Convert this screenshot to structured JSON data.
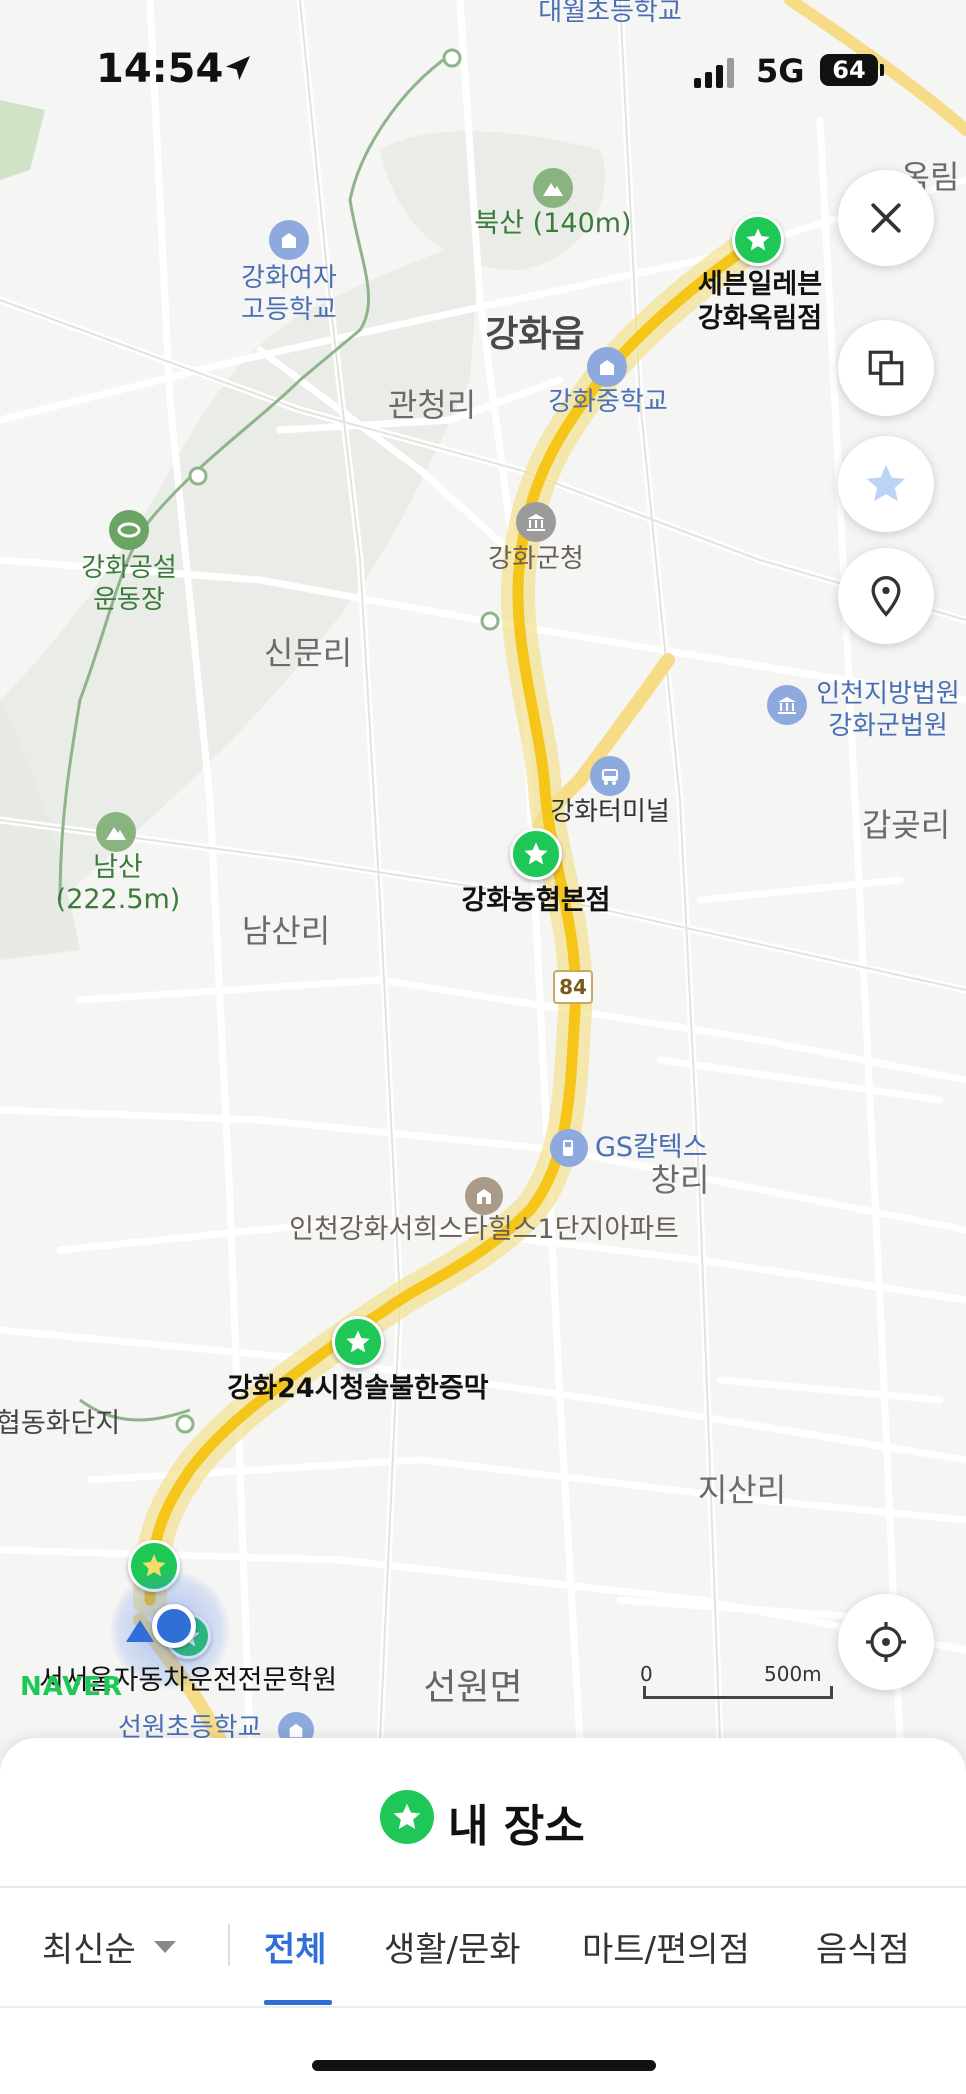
{
  "status_bar": {
    "time": "14:54",
    "network": "5G",
    "battery": "64"
  },
  "map": {
    "areas": {
      "ganghwa_eup": "강화읍",
      "gwancheong_ri": "관청리",
      "sinmun_ri": "신문리",
      "namsan_ri": "남산리",
      "gapgot_ri": "갑곶리",
      "changri": "창리",
      "jisan_ri": "지산리",
      "seonwon_myeon": "선원면",
      "ok_rim": "옥림"
    },
    "pois": {
      "daewol_school": "대월초등학교",
      "buksan": "북산 (140m)",
      "girls_high_1": "강화여자",
      "girls_high_2": "고등학교",
      "middle_school": "강화중학교",
      "gunchung": "강화군청",
      "stadium_1": "강화공설",
      "stadium_2": "운동장",
      "court_1": "인천지방법원",
      "court_2": "강화군법원",
      "terminal": "강화터미널",
      "namsan_1": "남산",
      "namsan_2": "(222.5m)",
      "gs": "GS칼텍스",
      "apartment": "인천강화서희스타힐스1단지아파트",
      "hyeopdong": "협동화단지",
      "seonwon_school": "선원초등학교"
    },
    "road_number": "84",
    "saved_places": {
      "seven_1": "세븐일레븐",
      "seven_2": "강화옥림점",
      "nonghyup": "강화농협본점",
      "jeungmak": "강화24시청솔불한증막",
      "driving": "서서울자동차운전전문학원"
    },
    "scale": {
      "zero": "0",
      "distance": "500m"
    },
    "brand": "NAVER"
  },
  "sheet": {
    "title": "내 장소",
    "sort_label": "최신순",
    "tabs": [
      "전체",
      "생활/문화",
      "마트/편의점",
      "음식점"
    ],
    "active_tab": 0
  },
  "colors": {
    "route": "#f6c51a",
    "pin": "#1fc856",
    "accent": "#2f6fd6"
  }
}
